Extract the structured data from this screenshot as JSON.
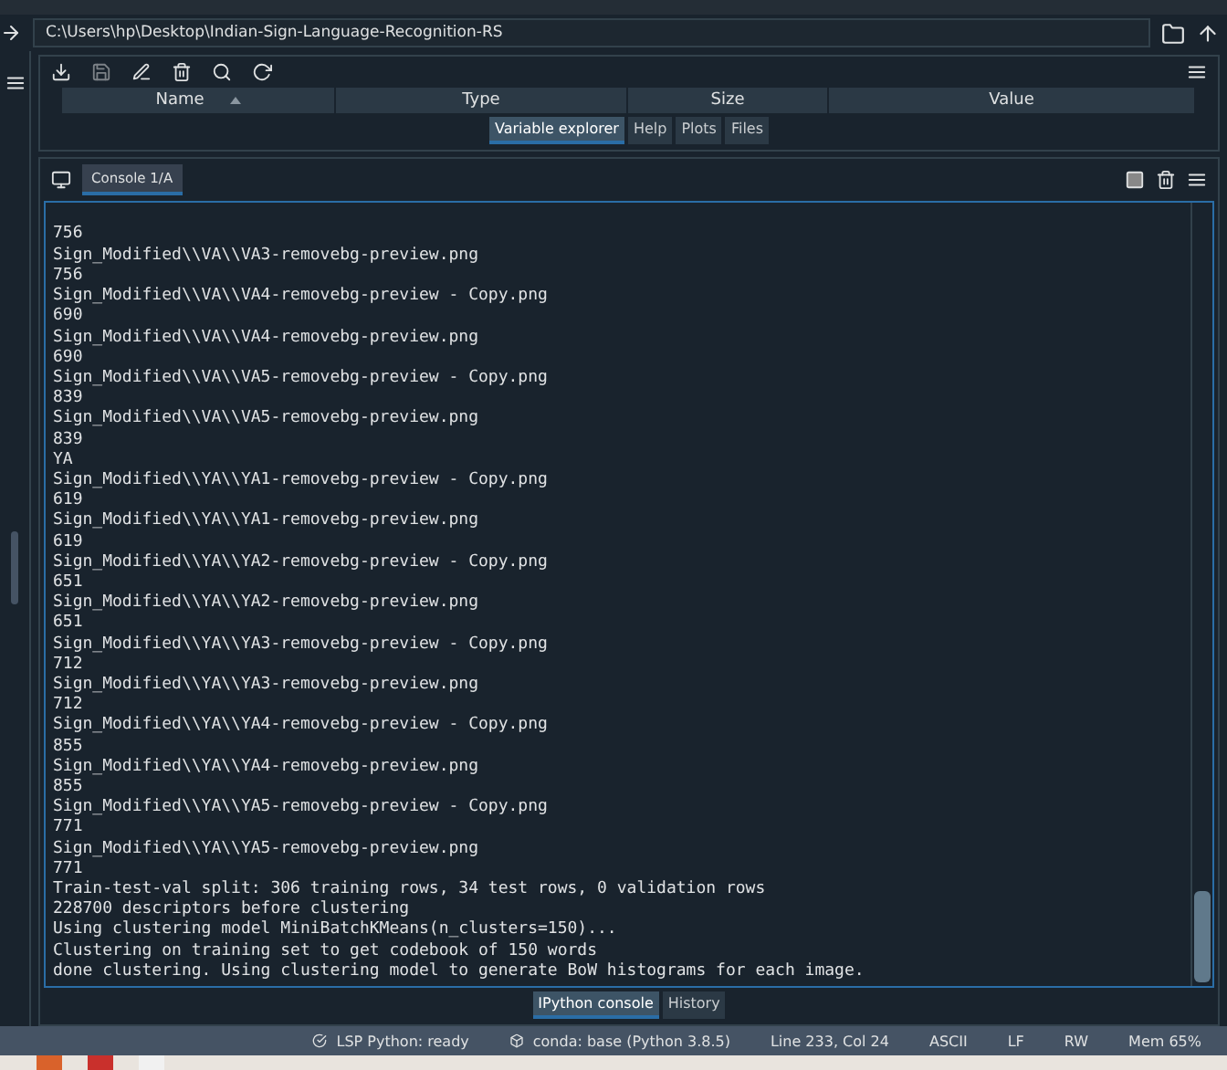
{
  "path_bar": {
    "value": "C:\\Users\\hp\\Desktop\\Indian-Sign-Language-Recognition-RS"
  },
  "variable_explorer": {
    "columns": [
      {
        "label": "Name",
        "sorted": true
      },
      {
        "label": "Type",
        "sorted": false
      },
      {
        "label": "Size",
        "sorted": false
      },
      {
        "label": "Value",
        "sorted": false
      }
    ]
  },
  "top_tabs": [
    {
      "label": "Variable explorer",
      "selected": true
    },
    {
      "label": "Help",
      "selected": false
    },
    {
      "label": "Plots",
      "selected": false
    },
    {
      "label": "Files",
      "selected": false
    }
  ],
  "console_tabs": [
    {
      "label": "Console 1/A",
      "selected": true
    }
  ],
  "console_lines": [
    "756",
    "Sign_Modified\\\\VA\\\\VA3-removebg-preview.png",
    "756",
    "Sign_Modified\\\\VA\\\\VA4-removebg-preview - Copy.png",
    "690",
    "Sign_Modified\\\\VA\\\\VA4-removebg-preview.png",
    "690",
    "Sign_Modified\\\\VA\\\\VA5-removebg-preview - Copy.png",
    "839",
    "Sign_Modified\\\\VA\\\\VA5-removebg-preview.png",
    "839",
    "YA",
    "Sign_Modified\\\\YA\\\\YA1-removebg-preview - Copy.png",
    "619",
    "Sign_Modified\\\\YA\\\\YA1-removebg-preview.png",
    "619",
    "Sign_Modified\\\\YA\\\\YA2-removebg-preview - Copy.png",
    "651",
    "Sign_Modified\\\\YA\\\\YA2-removebg-preview.png",
    "651",
    "Sign_Modified\\\\YA\\\\YA3-removebg-preview - Copy.png",
    "712",
    "Sign_Modified\\\\YA\\\\YA3-removebg-preview.png",
    "712",
    "Sign_Modified\\\\YA\\\\YA4-removebg-preview - Copy.png",
    "855",
    "Sign_Modified\\\\YA\\\\YA4-removebg-preview.png",
    "855",
    "Sign_Modified\\\\YA\\\\YA5-removebg-preview - Copy.png",
    "771",
    "Sign_Modified\\\\YA\\\\YA5-removebg-preview.png",
    "771",
    "Train-test-val split: 306 training rows, 34 test rows, 0 validation rows",
    "228700 descriptors before clustering",
    "Using clustering model MiniBatchKMeans(n_clusters=150)...",
    "Clustering on training set to get codebook of 150 words",
    "done clustering. Using clustering model to generate BoW histograms for each image."
  ],
  "bottom_tabs": [
    {
      "label": "IPython console",
      "selected": true
    },
    {
      "label": "History",
      "selected": false
    }
  ],
  "status_bar": [
    {
      "kind": "lsp",
      "text": "LSP Python: ready"
    },
    {
      "kind": "conda",
      "text": "conda: base (Python 3.8.5)"
    },
    {
      "kind": "plain",
      "text": "Line 233, Col 24"
    },
    {
      "kind": "plain",
      "text": "ASCII"
    },
    {
      "kind": "plain",
      "text": "LF"
    },
    {
      "kind": "plain",
      "text": "RW"
    },
    {
      "kind": "plain",
      "text": "Mem 65%"
    }
  ]
}
